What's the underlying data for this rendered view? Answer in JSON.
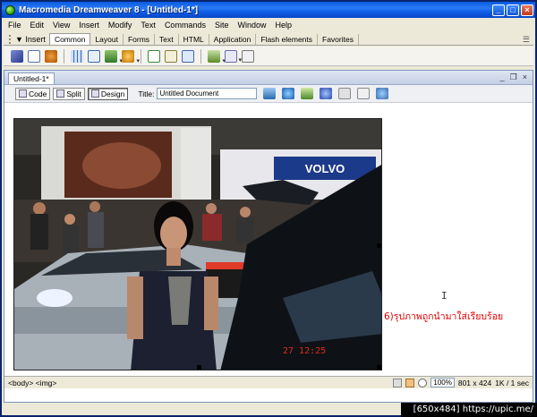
{
  "window": {
    "title": "Macromedia Dreamweaver 8 - [Untitled-1*]"
  },
  "menu": [
    "File",
    "Edit",
    "View",
    "Insert",
    "Modify",
    "Text",
    "Commands",
    "Site",
    "Window",
    "Help"
  ],
  "insert_bar": {
    "label": "Insert",
    "tabs": [
      "Common",
      "Layout",
      "Forms",
      "Text",
      "HTML",
      "Application",
      "Flash elements",
      "Favorites"
    ]
  },
  "document": {
    "tab": "Untitled-1*",
    "view_buttons": {
      "code": "Code",
      "split": "Split",
      "design": "Design"
    },
    "title_label": "Title:",
    "title_value": "Untitled Document"
  },
  "photo": {
    "banner_text": "VOLVO",
    "timestamp": "27  12:25"
  },
  "caption": "6)รุปภาพถูกนำมาใส่เรียบร้อย",
  "status": {
    "tags": "<body> <img>",
    "zoom": "100%",
    "dimensions": "801 x 424",
    "download": "1K / 1 sec"
  },
  "watermark": "[650x484] https://upic.me/",
  "colors": {
    "titlebar": "#0a5ae0",
    "caption": "#e00000"
  }
}
